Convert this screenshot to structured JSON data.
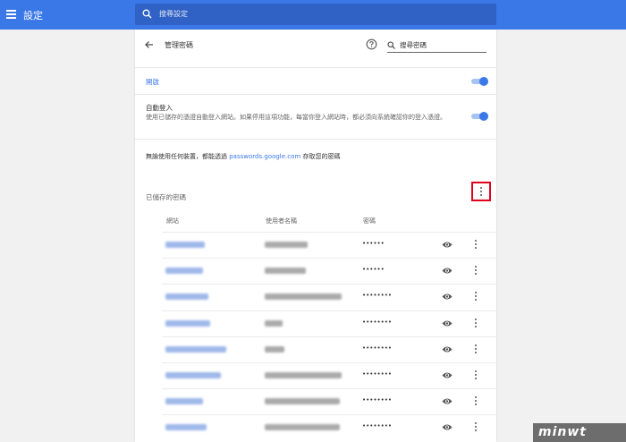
{
  "app": {
    "title": "設定"
  },
  "search": {
    "placeholder": "搜尋設定"
  },
  "header": {
    "title": "管理密碼",
    "search_placeholder": "搜尋密碼"
  },
  "settings": {
    "offer_label": "開啟",
    "offer_enabled": true,
    "auto_signin_title": "自動登入",
    "auto_signin_desc": "使用已儲存的憑證自動登入網站。如果停用這項功能，每當你登入網站時，都必須向系統確認你的登入憑證。",
    "auto_signin_enabled": true,
    "sync_prefix": "無論使用任何裝置，都能透過 ",
    "sync_link": "passwords.google.com",
    "sync_suffix": " 存取您的密碼"
  },
  "saved": {
    "title": "已儲存的密碼",
    "columns": {
      "site": "網站",
      "username": "使用者名稱",
      "password": "密碼"
    },
    "rows": [
      {
        "password": "••••••"
      },
      {
        "password": "••••••"
      },
      {
        "password": "••••••••"
      },
      {
        "password": "••••••••"
      },
      {
        "password": "••••••••"
      },
      {
        "password": "••••••••"
      },
      {
        "password": "••••••••"
      },
      {
        "password": "••••••••"
      }
    ]
  },
  "watermark": "minwt"
}
